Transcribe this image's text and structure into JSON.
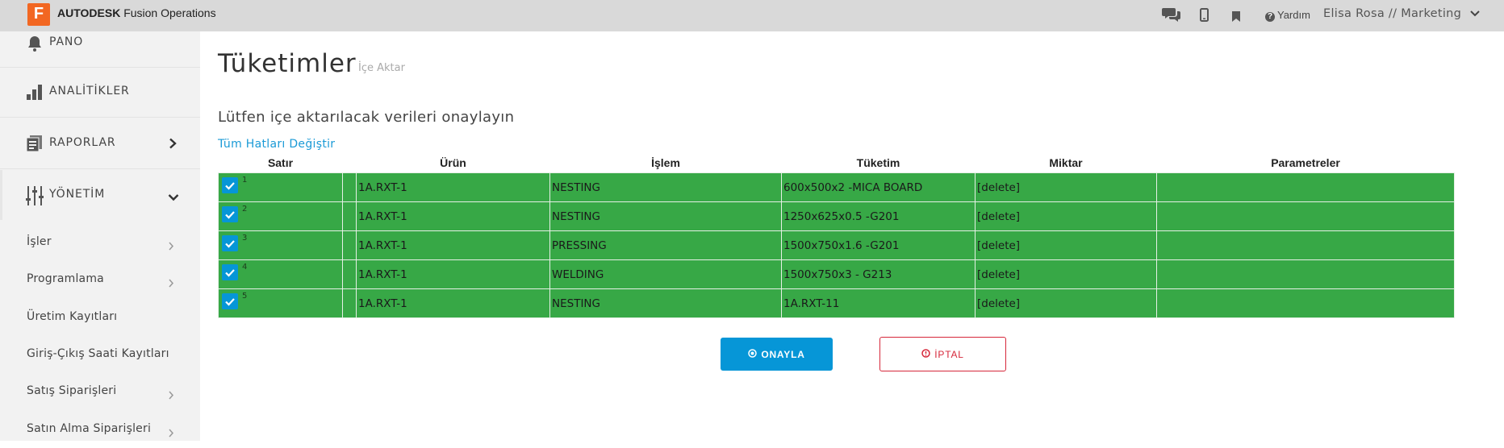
{
  "app": {
    "logo_letter": "F",
    "brand_bold": "AUTODESK",
    "brand_rest": " Fusion Operations",
    "accent_color": "#f26722"
  },
  "topbar": {
    "icons": [
      "chat-icon",
      "mobile-icon",
      "bookmark-icon"
    ],
    "help_label": "Yardım",
    "user_label": "Elisa Rosa // Marketing"
  },
  "sidebar": {
    "main_items": [
      {
        "label": "PANO",
        "icon": "bell-icon"
      },
      {
        "label": "ANALİTİKLER",
        "icon": "bar-chart-icon"
      },
      {
        "label": "RAPORLAR",
        "icon": "report-icon",
        "chevron": "right"
      },
      {
        "label": "YÖNETİM",
        "icon": "sliders-icon",
        "chevron": "down"
      }
    ],
    "sub_items": [
      {
        "label": "İşler",
        "chevron": true
      },
      {
        "label": "Programlama",
        "chevron": true
      },
      {
        "label": "Üretim Kayıtları",
        "chevron": false
      },
      {
        "label": "Giriş-Çıkış Saati Kayıtları",
        "chevron": false
      },
      {
        "label": "Satış Siparişleri",
        "chevron": true
      },
      {
        "label": "Satın Alma Siparişleri",
        "chevron": true
      }
    ]
  },
  "main": {
    "title": "Tüketimler",
    "subtitle": "İçe Aktar",
    "confirm_text": "Lütfen içe aktarılacak verileri onaylayın",
    "toggle_all_link": "Tüm Hatları Değiştir",
    "table": {
      "headers": [
        "Satır",
        "Ürün",
        "İşlem",
        "Tüketim",
        "Miktar",
        "Parametreler"
      ],
      "row_color": "#37a846",
      "rows": [
        {
          "num": "1",
          "checked": true,
          "urun": "1A.RXT-1",
          "islem": "NESTING",
          "tuketim": "600x500x2 -MICA BOARD",
          "miktar": "[delete]",
          "parametreler": ""
        },
        {
          "num": "2",
          "checked": true,
          "urun": "1A.RXT-1",
          "islem": "NESTING",
          "tuketim": "1250x625x0.5 -G201",
          "miktar": "[delete]",
          "parametreler": ""
        },
        {
          "num": "3",
          "checked": true,
          "urun": "1A.RXT-1",
          "islem": "PRESSING",
          "tuketim": "1500x750x1.6 -G201",
          "miktar": "[delete]",
          "parametreler": ""
        },
        {
          "num": "4",
          "checked": true,
          "urun": "1A.RXT-1",
          "islem": "WELDING",
          "tuketim": "1500x750x3 - G213",
          "miktar": "[delete]",
          "parametreler": ""
        },
        {
          "num": "5",
          "checked": true,
          "urun": "1A.RXT-1",
          "islem": "NESTING",
          "tuketim": "1A.RXT-11",
          "miktar": "[delete]",
          "parametreler": ""
        }
      ]
    },
    "buttons": {
      "confirm": "ONAYLA",
      "cancel": "İPTAL",
      "confirm_color": "#0696d7",
      "cancel_color": "#d6273a"
    }
  }
}
